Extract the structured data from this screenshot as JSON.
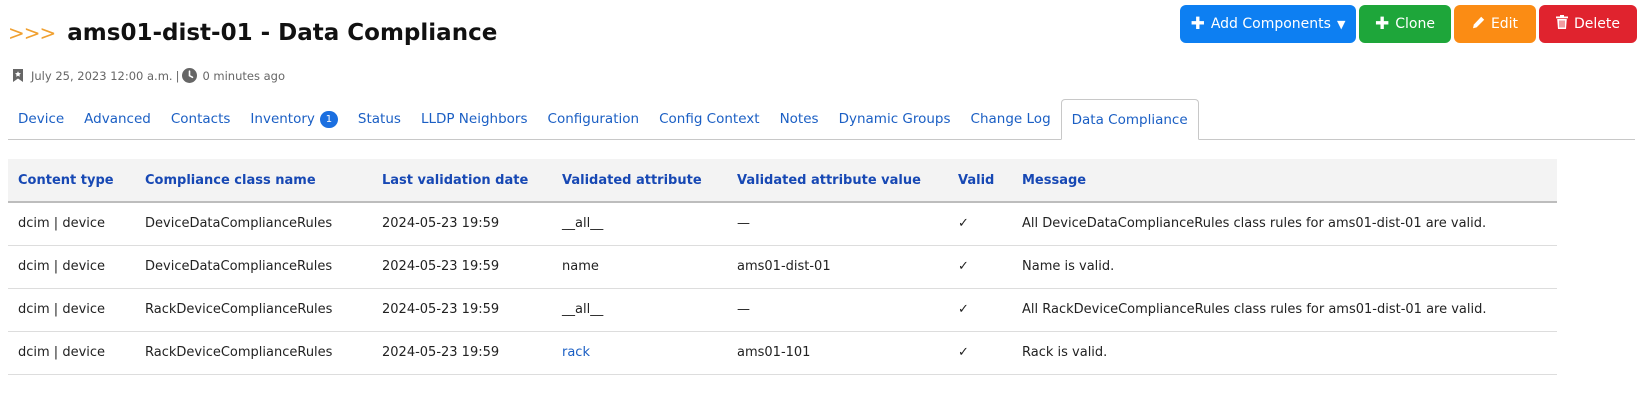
{
  "header": {
    "breadcrumb_glyph": ">>>",
    "title": "ams01-dist-01 - Data Compliance"
  },
  "meta": {
    "created": "July 25, 2023 12:00 a.m.",
    "separator": "|",
    "updated": "0 minutes ago"
  },
  "actions": {
    "add_components": "Add Components",
    "clone": "Clone",
    "edit": "Edit",
    "delete": "Delete"
  },
  "tabs": [
    {
      "label": "Device"
    },
    {
      "label": "Advanced"
    },
    {
      "label": "Contacts"
    },
    {
      "label": "Inventory",
      "badge": "1"
    },
    {
      "label": "Status"
    },
    {
      "label": "LLDP Neighbors"
    },
    {
      "label": "Configuration"
    },
    {
      "label": "Config Context"
    },
    {
      "label": "Notes"
    },
    {
      "label": "Dynamic Groups"
    },
    {
      "label": "Change Log"
    },
    {
      "label": "Data Compliance",
      "active": true
    }
  ],
  "table": {
    "headers": [
      "Content type",
      "Compliance class name",
      "Last validation date",
      "Validated attribute",
      "Validated attribute value",
      "Valid",
      "Message"
    ],
    "rows": [
      {
        "content_type": "dcim | device",
        "class_name": "DeviceDataComplianceRules",
        "date": "2024-05-23 19:59",
        "attribute": "__all__",
        "attribute_link": false,
        "value": "—",
        "valid": "✓",
        "message": "All DeviceDataComplianceRules class rules for ams01-dist-01 are valid."
      },
      {
        "content_type": "dcim | device",
        "class_name": "DeviceDataComplianceRules",
        "date": "2024-05-23 19:59",
        "attribute": "name",
        "attribute_link": false,
        "value": "ams01-dist-01",
        "valid": "✓",
        "message": "Name is valid."
      },
      {
        "content_type": "dcim | device",
        "class_name": "RackDeviceComplianceRules",
        "date": "2024-05-23 19:59",
        "attribute": "__all__",
        "attribute_link": false,
        "value": "—",
        "valid": "✓",
        "message": "All RackDeviceComplianceRules class rules for ams01-dist-01 are valid."
      },
      {
        "content_type": "dcim | device",
        "class_name": "RackDeviceComplianceRules",
        "date": "2024-05-23 19:59",
        "attribute": "rack",
        "attribute_link": true,
        "value": "ams01-101",
        "valid": "✓",
        "message": "Rack is valid."
      }
    ]
  },
  "icons": {
    "bookmark": "bookmark-icon",
    "clock": "clock-icon",
    "plus": "plus-icon",
    "caret": "caret-down-icon",
    "pencil": "pencil-icon",
    "trash": "trash-icon"
  },
  "colors": {
    "primary": "#0d7ff2",
    "success": "#1ea63a",
    "warning": "#fb8c14",
    "danger": "#e0232e",
    "link": "#1b5fc4",
    "accent_chevron": "#f0a030"
  }
}
